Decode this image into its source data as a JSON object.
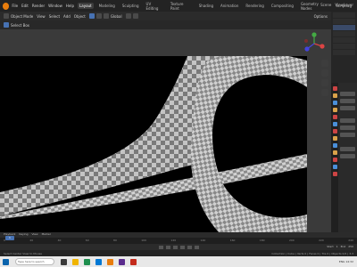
{
  "menu": {
    "items": [
      "File",
      "Edit",
      "Render",
      "Window",
      "Help"
    ],
    "workspaces": [
      "Layout",
      "Modeling",
      "Sculpting",
      "UV Editing",
      "Texture Paint",
      "Shading",
      "Animation",
      "Rendering",
      "Compositing",
      "Geometry Nodes",
      "Scripting"
    ],
    "active_workspace": "Layout",
    "scene_label": "Scene",
    "view_layer_label": "ViewLayer"
  },
  "header": {
    "mode": "Object Mode",
    "view": "View",
    "select": "Select",
    "add": "Add",
    "object": "Object",
    "transform": "Global",
    "snap_options": "Options"
  },
  "toolbar": {
    "text": "Select Box"
  },
  "timeline": {
    "frame_current": "1",
    "ticks": [
      "0",
      "20",
      "40",
      "60",
      "80",
      "100",
      "120",
      "140",
      "160",
      "180",
      "200",
      "220",
      "240"
    ],
    "playback": "Playback",
    "keying": "Keying",
    "view": "View",
    "marker": "Marker",
    "start_label": "Start",
    "start": "1",
    "end_label": "End",
    "end": "250"
  },
  "status": {
    "left": "Select   Center View to Mouse",
    "right": "Collection | Cube | Verts 0 | Faces 0 | Tris 0 | Objects 0/2 | 3.3"
  },
  "taskbar": {
    "search_placeholder": "Type here to search",
    "tray_text": "ENG  14:32"
  },
  "colors": {
    "accent": "#4772b3",
    "blender_orange": "#e87d0d",
    "checker_light": "#bdbdbd",
    "checker_dark": "#7a7a7a"
  }
}
